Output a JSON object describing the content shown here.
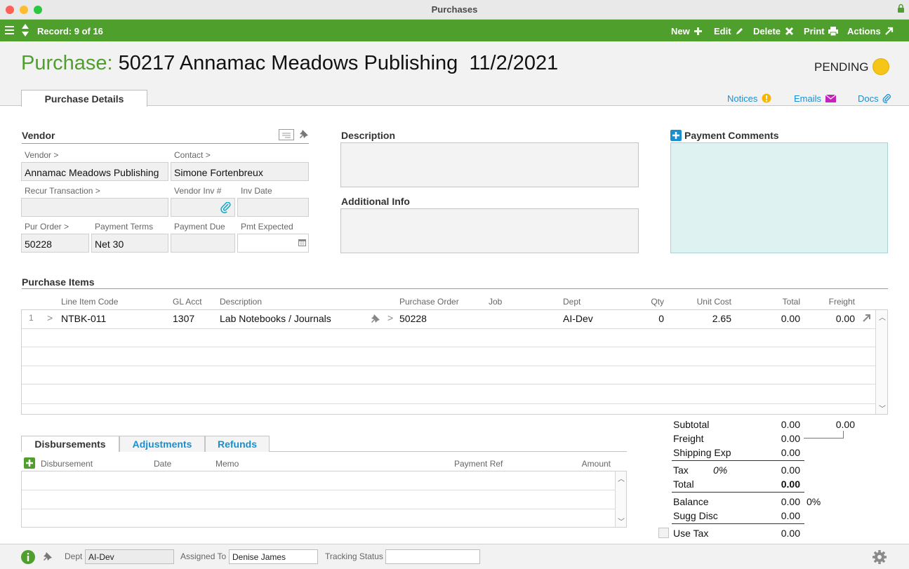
{
  "window": {
    "title": "Purchases"
  },
  "toolbar": {
    "record": "Record: 9 of 16",
    "new": "New",
    "edit": "Edit",
    "delete": "Delete",
    "print": "Print",
    "actions": "Actions"
  },
  "header": {
    "label": "Purchase:",
    "title": "50217 Annamac Meadows Publishing  11/2/2021",
    "status": "PENDING",
    "status_color": "#f5c518"
  },
  "tabs": {
    "details": "Purchase Details",
    "notices": "Notices",
    "emails": "Emails",
    "docs": "Docs"
  },
  "vendor": {
    "section": "Vendor",
    "vendor_label": "Vendor >",
    "vendor_value": "Annamac Meadows Publishing",
    "contact_label": "Contact >",
    "contact_value": "Simone Fortenbreux",
    "recur_label": "Recur Transaction >",
    "recur_value": "",
    "vendor_inv_label": "Vendor Inv #",
    "vendor_inv_value": "",
    "inv_date_label": "Inv Date",
    "inv_date_value": "",
    "pur_order_label": "Pur Order >",
    "pur_order_value": "50228",
    "payment_terms_label": "Payment Terms",
    "payment_terms_value": "Net 30",
    "payment_due_label": "Payment Due",
    "payment_due_value": "",
    "pmt_expected_label": "Pmt Expected",
    "pmt_expected_value": ""
  },
  "description": {
    "label": "Description",
    "value": ""
  },
  "additional": {
    "label": "Additional Info",
    "value": ""
  },
  "payment_comments": {
    "label": "Payment Comments",
    "value": ""
  },
  "items": {
    "section": "Purchase Items",
    "columns": [
      "Line Item Code",
      "GL Acct",
      "Description",
      "Purchase Order",
      "Job",
      "Dept",
      "Qty",
      "Unit Cost",
      "Total",
      "Freight"
    ],
    "rows": [
      {
        "num": "1",
        "code": "NTBK-011",
        "gl": "1307",
        "description": "Lab Notebooks / Journals",
        "po": "50228",
        "job": "",
        "dept": "AI-Dev",
        "qty": "0",
        "unit_cost": "2.65",
        "total": "0.00",
        "freight": "0.00"
      }
    ]
  },
  "lower_tabs": {
    "disbursements": "Disbursements",
    "adjustments": "Adjustments",
    "refunds": "Refunds"
  },
  "disb": {
    "columns": [
      "Disbursement",
      "Date",
      "Memo",
      "Payment Ref",
      "Amount"
    ]
  },
  "totals": {
    "subtotal_label": "Subtotal",
    "subtotal": "0.00",
    "subtotal_extra": "0.00",
    "freight_label": "Freight",
    "freight": "0.00",
    "shipping_label": "Shipping Exp",
    "shipping": "0.00",
    "tax_label": "Tax",
    "tax_pct": "0%",
    "tax": "0.00",
    "total_label": "Total",
    "total": "0.00",
    "balance_label": "Balance",
    "balance": "0.00",
    "balance_pct": "0%",
    "sugg_label": "Sugg Disc",
    "sugg": "0.00",
    "use_tax_label": "Use Tax",
    "use_tax": "0.00"
  },
  "footer": {
    "dept_label": "Dept",
    "dept_value": "AI-Dev",
    "assigned_label": "Assigned To",
    "assigned_value": "Denise James",
    "tracking_label": "Tracking Status",
    "tracking_value": ""
  },
  "colors": {
    "accent": "#4f9f2c",
    "link": "#1a8fd0",
    "comments_bg": "#dff2f2"
  }
}
